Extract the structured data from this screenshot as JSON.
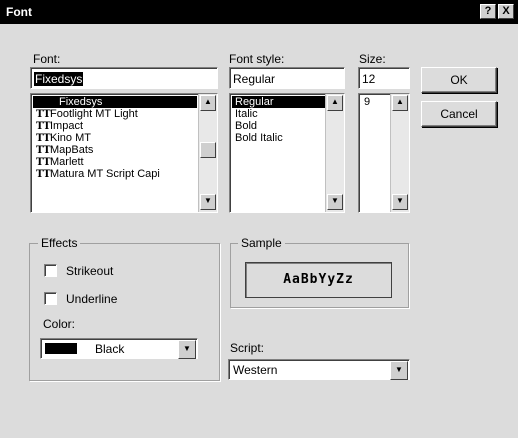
{
  "window": {
    "title": "Font",
    "help_button": "?",
    "close_button": "X"
  },
  "font": {
    "label": "Font:",
    "value": "Fixedsys",
    "items": [
      {
        "name": "Fixedsys",
        "icon": "",
        "selected": true
      },
      {
        "name": "Footlight MT Light",
        "icon": "truetype-icon",
        "selected": false
      },
      {
        "name": "Impact",
        "icon": "truetype-icon",
        "selected": false
      },
      {
        "name": "Kino MT",
        "icon": "truetype-icon",
        "selected": false
      },
      {
        "name": "MapBats",
        "icon": "truetype-icon",
        "selected": false
      },
      {
        "name": "Marlett",
        "icon": "truetype-icon",
        "selected": false
      },
      {
        "name": "Matura MT Script Capi",
        "icon": "truetype-icon",
        "selected": false
      }
    ]
  },
  "font_style": {
    "label": "Font style:",
    "value": "Regular",
    "items": [
      "Regular",
      "Italic",
      "Bold",
      "Bold Italic"
    ],
    "selected_index": 0
  },
  "size": {
    "label": "Size:",
    "value": "12",
    "items": [
      "9"
    ],
    "selected_index": -1
  },
  "buttons": {
    "ok": "OK",
    "cancel": "Cancel"
  },
  "effects": {
    "title": "Effects",
    "strikeout_label": "Strikeout",
    "underline_label": "Underline",
    "strikeout_checked": false,
    "underline_checked": false,
    "color_label": "Color:",
    "color_value": "Black",
    "color_swatch": "#000000"
  },
  "sample": {
    "title": "Sample",
    "text": "AaBbYyZz"
  },
  "script": {
    "label": "Script:",
    "value": "Western"
  },
  "icons": {
    "truetype": "TT",
    "scroll_up": "▲",
    "scroll_down": "▼",
    "dropdown": "▼"
  }
}
